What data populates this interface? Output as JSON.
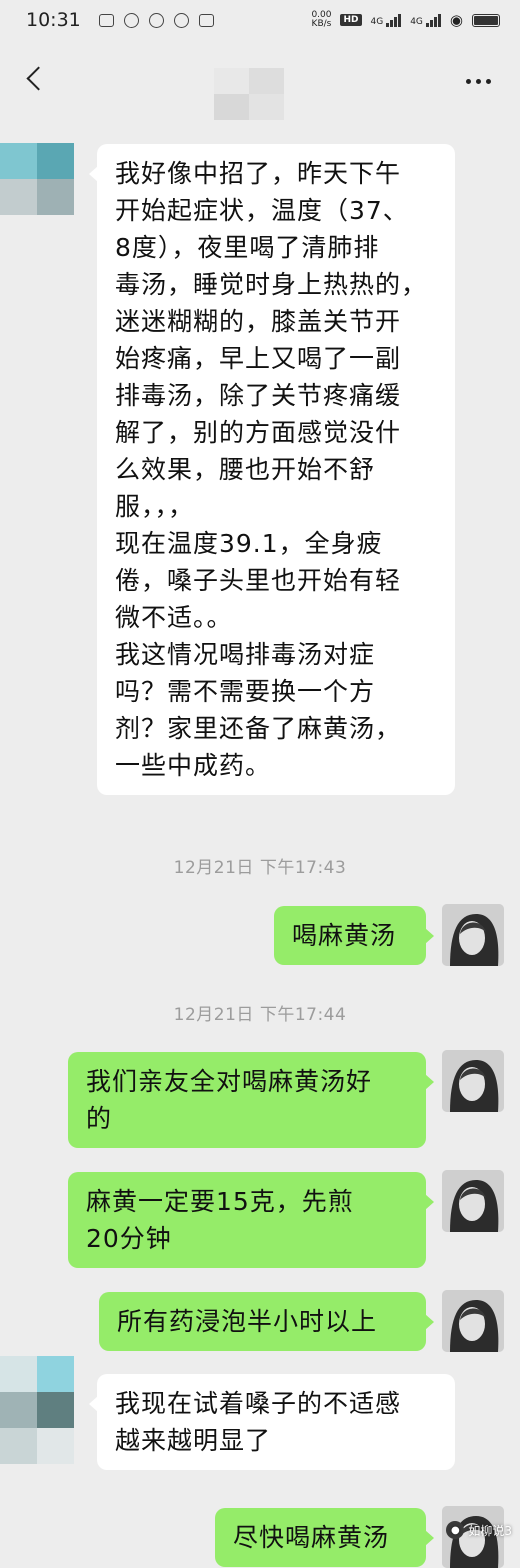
{
  "status_bar": {
    "time": "10:31",
    "speed_value": "0.00",
    "speed_unit": "KB/s",
    "hd_label": "HD",
    "net1": "4G",
    "net2": "4G"
  },
  "messages": [
    {
      "side": "left",
      "text": "我好像中招了，昨天下午\n开始起症状，温度（37、\n8度），夜里喝了清肺排\n毒汤，睡觉时身上热热的，\n迷迷糊糊的，膝盖关节开\n始疼痛，早上又喝了一副\n排毒汤，除了关节疼痛缓\n解了，别的方面感觉没什\n么效果，腰也开始不舒\n服，，，\n现在温度39.1，全身疲\n倦，嗓子头里也开始有轻\n微不适。。\n我这情况喝排毒汤对症\n吗？需不需要换一个方\n剂？家里还备了麻黄汤，\n一些中成药。"
    },
    {
      "side": "right",
      "text": "喝麻黄汤"
    },
    {
      "side": "right",
      "text": "我们亲友全对喝麻黄汤好\n的"
    },
    {
      "side": "right",
      "text": "麻黄一定要15克，先煎\n20分钟"
    },
    {
      "side": "right",
      "text": "所有药浸泡半小时以上"
    },
    {
      "side": "left",
      "text": "我现在试着嗓子的不适感\n越来越明显了"
    },
    {
      "side": "right",
      "text": "尽快喝麻黄汤"
    }
  ],
  "timestamps": [
    "12月21日 下午17:43",
    "12月21日 下午17:44"
  ],
  "watermark": {
    "text": "如柳说3"
  },
  "colors": {
    "background": "#ededed",
    "bubble_self": "#95ec69",
    "bubble_other": "#ffffff",
    "timestamp": "#9c9c9c"
  },
  "icons": {
    "back": "chevron-left-icon",
    "more": "more-dots-icon"
  }
}
